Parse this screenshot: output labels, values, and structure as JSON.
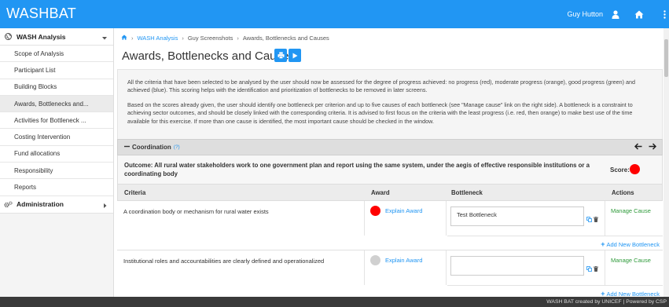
{
  "header": {
    "brand": "WASHBAT",
    "user_name": "Guy Hutton"
  },
  "sidebar": {
    "wash_analysis_label": "WASH Analysis",
    "items": [
      {
        "label": "Scope of Analysis"
      },
      {
        "label": "Participant List"
      },
      {
        "label": "Building Blocks"
      },
      {
        "label": "Awards, Bottlenecks and..."
      },
      {
        "label": "Activities for Bottleneck ..."
      },
      {
        "label": "Costing Intervention"
      },
      {
        "label": "Fund allocations"
      },
      {
        "label": "Responsibility"
      },
      {
        "label": "Reports"
      }
    ],
    "administration_label": "Administration"
  },
  "breadcrumb": {
    "level1": "WASH Analysis",
    "level2": "Guy Screenshots",
    "level3": "Awards, Bottlenecks and Causes"
  },
  "page": {
    "title": "Awards, Bottlenecks and Causes"
  },
  "info": {
    "para1": "All the criteria that have been selected to be analysed by the user should now be assessed for the degree of progress achieved: no progress (red), moderate progress (orange), good progress (green) and achieved (blue). This scoring helps with the identification and prioritization of bottlenecks to be removed in later screens.",
    "para2": "Based on the scores already given, the user should identify one bottleneck per criterion and up to five causes of each bottleneck (see \"Manage cause\" link on the right side). A bottleneck is a constraint to achieving sector outcomes, and should be closely linked with the corresponding criteria. It is advised to first focus on the criteria with the least progress (i.e. red, then orange) to make best use of the time available for this exercise. If more than one cause is identified, the most important cause should be checked in the window."
  },
  "section": {
    "title": "Coordination",
    "help": "(?)"
  },
  "outcome": {
    "text": "Outcome: All rural water stakeholders work to one government plan and report using the same system, under the aegis of effective responsible institutions or a coordinating body",
    "score_label": "Score:",
    "score_color": "#ff0000"
  },
  "table": {
    "headers": {
      "criteria": "Criteria",
      "award": "Award",
      "bottleneck": "Bottleneck",
      "actions": "Actions"
    },
    "rows": [
      {
        "criteria": "A coordination body or mechanism for rural water exists",
        "award_color": "#ff0000",
        "explain": "Explain Award",
        "bottleneck": "Test Bottleneck",
        "manage": "Manage Cause",
        "add": "Add New Bottleneck"
      },
      {
        "criteria": "Institutional roles and accountabilities are clearly defined and operationalized",
        "award_color": "#d0d0d0",
        "explain": "Explain Award",
        "bottleneck": "",
        "manage": "Manage Cause",
        "add": "Add New Bottleneck"
      }
    ]
  },
  "footer": {
    "text": "WASH BAT created by UNICEF | Powered by CSP"
  }
}
